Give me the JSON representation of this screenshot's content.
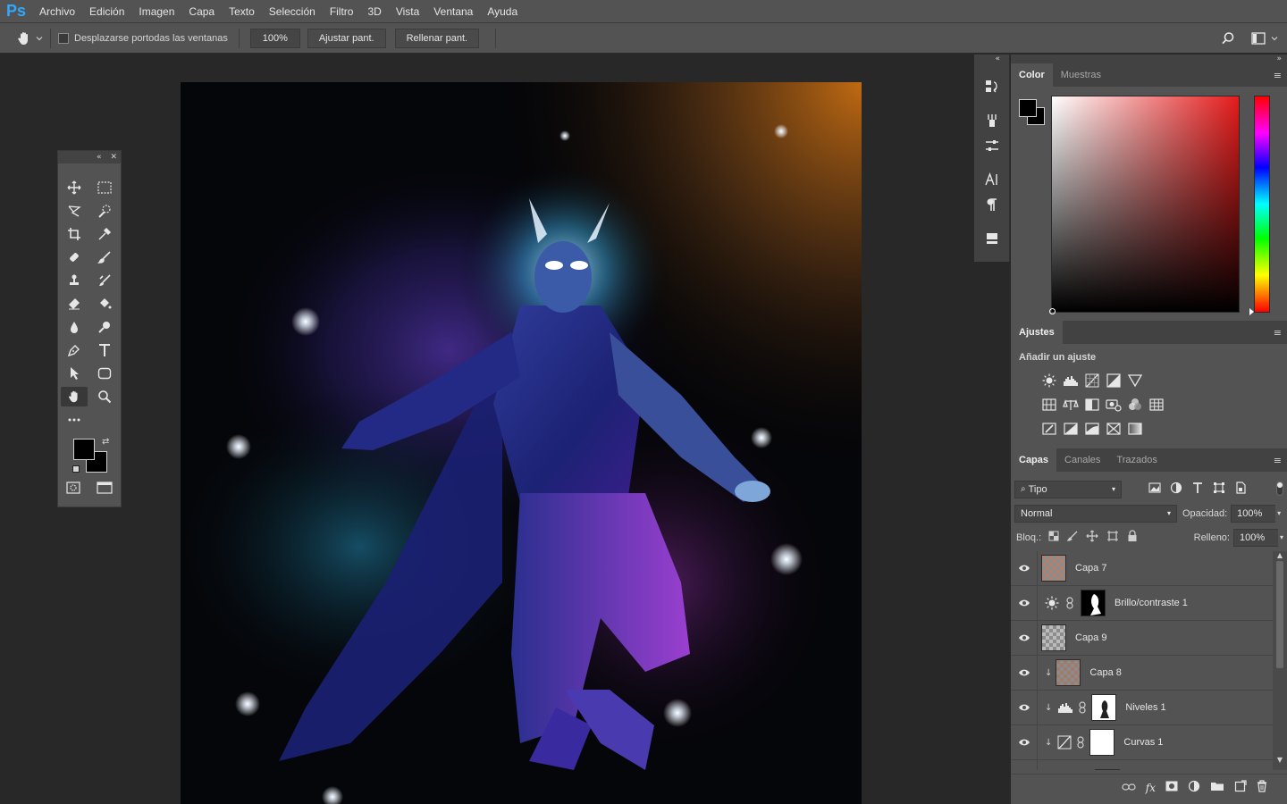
{
  "app": {
    "logo": "Ps"
  },
  "menu": [
    "Archivo",
    "Edición",
    "Imagen",
    "Capa",
    "Texto",
    "Selección",
    "Filtro",
    "3D",
    "Vista",
    "Ventana",
    "Ayuda"
  ],
  "options": {
    "scroll_all_label": "Desplazarse portodas las ventanas",
    "zoom_value": "100%",
    "fit_screen": "Ajustar pant.",
    "fill_screen": "Rellenar pant."
  },
  "color_panel": {
    "tabs": [
      "Color",
      "Muestras"
    ],
    "foreground": "#000000",
    "background": "#000000"
  },
  "adjustments_panel": {
    "tab": "Ajustes",
    "title": "Añadir un ajuste"
  },
  "layers_panel": {
    "tabs": [
      "Capas",
      "Canales",
      "Trazados"
    ],
    "filter_kind": "Tipo",
    "blend_mode": "Normal",
    "opacity_label": "Opacidad:",
    "opacity_value": "100%",
    "lock_label": "Bloq.:",
    "fill_label": "Relleno:",
    "fill_value": "100%",
    "layers": [
      {
        "name": "Capa 7",
        "type": "pixel",
        "clipped": false
      },
      {
        "name": "Brillo/contraste 1",
        "type": "adjustment-brightness",
        "clipped": false
      },
      {
        "name": "Capa 9",
        "type": "pixel",
        "clipped": false
      },
      {
        "name": "Capa 8",
        "type": "pixel",
        "clipped": true
      },
      {
        "name": "Niveles 1",
        "type": "adjustment-levels",
        "clipped": true
      },
      {
        "name": "Curvas 1",
        "type": "adjustment-curves",
        "clipped": true
      }
    ]
  },
  "colors": {
    "ps_blue": "#31a8ff",
    "panel_bg": "#535353",
    "workspace_bg": "#282828"
  }
}
